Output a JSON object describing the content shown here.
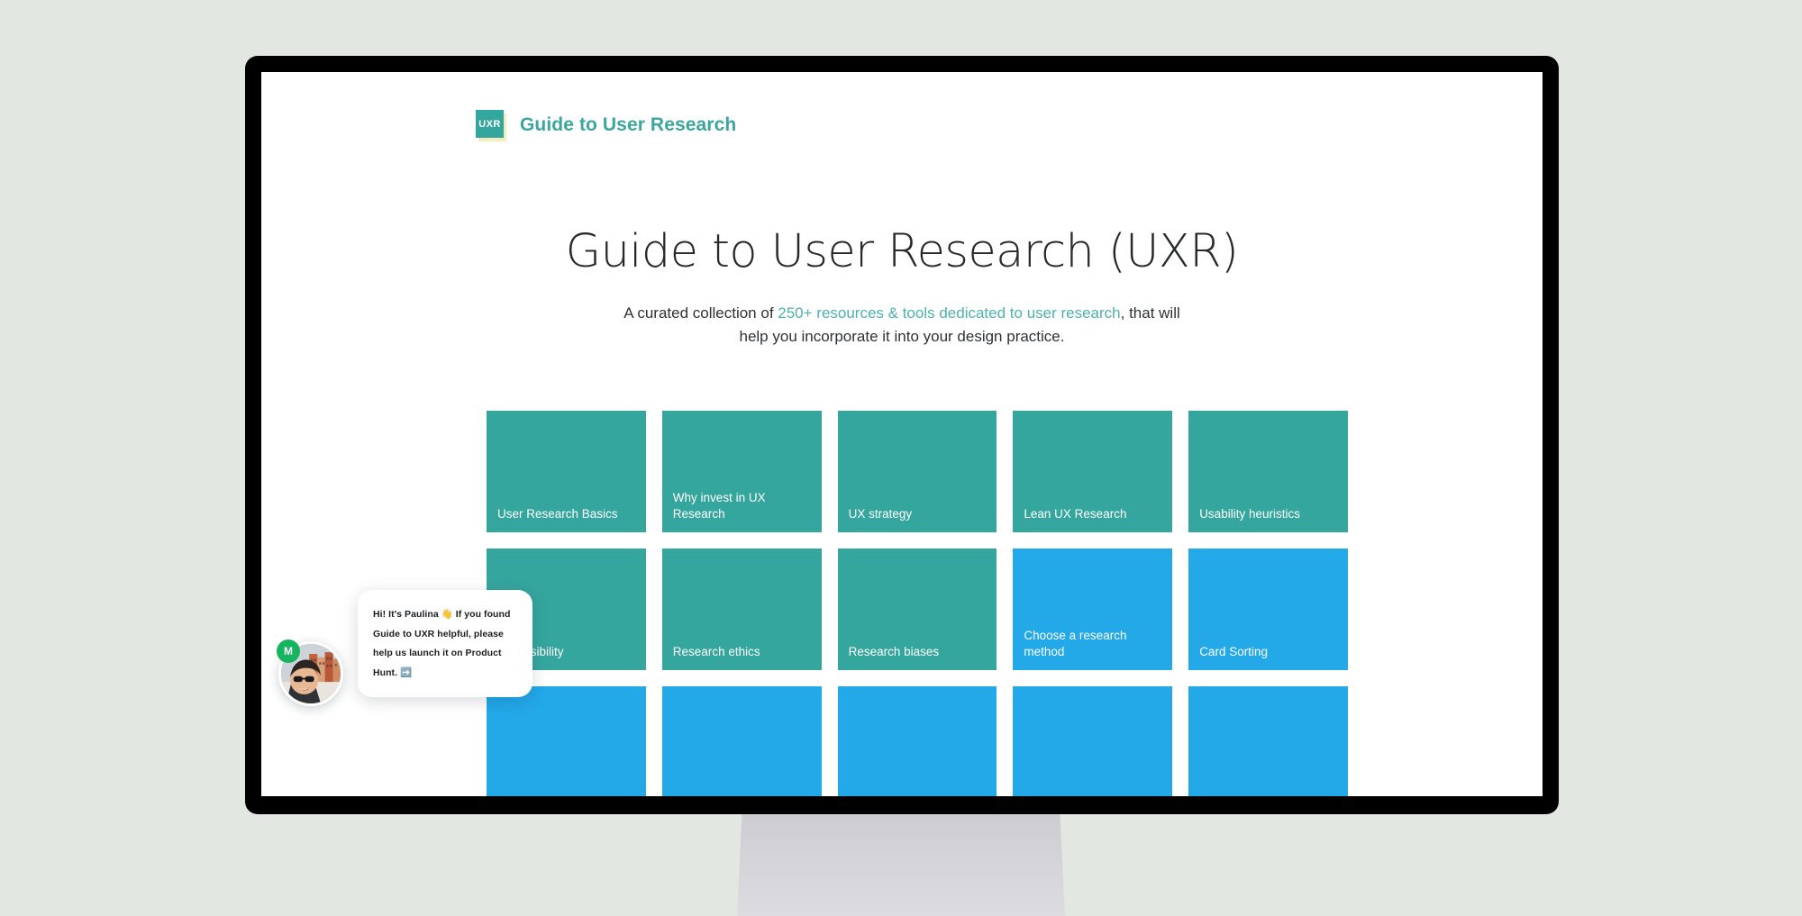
{
  "page": {
    "background_color": "#e2e7e2"
  },
  "monitor": {
    "bezel_color": "#000000",
    "stand_name": "monitor-stand"
  },
  "header": {
    "logo_text": "UXR",
    "brand_name": "Guide to User Research",
    "brand_color": "#3aa69d"
  },
  "hero": {
    "title": "Guide to User Research (UXR)",
    "subtitle_before": "A curated collection of ",
    "subtitle_link": "250+ resources & tools dedicated to user research",
    "subtitle_after": ", that will help you incorporate it into your design practice.",
    "link_color": "#4cb3ad"
  },
  "colors": {
    "teal": "#35a69e",
    "blue": "#23a8e8",
    "white": "#ffffff"
  },
  "cards": [
    {
      "label": "User Research Basics",
      "color": "#35a69e"
    },
    {
      "label": "Why invest in UX Research",
      "color": "#35a69e"
    },
    {
      "label": "UX strategy",
      "color": "#35a69e"
    },
    {
      "label": "Lean UX Research",
      "color": "#35a69e"
    },
    {
      "label": "Usability heuristics",
      "color": "#35a69e"
    },
    {
      "label": "Accessibility",
      "color": "#35a69e"
    },
    {
      "label": "Research ethics",
      "color": "#35a69e"
    },
    {
      "label": "Research biases",
      "color": "#35a69e"
    },
    {
      "label": "Choose a research method",
      "color": "#23a8e8"
    },
    {
      "label": "Card Sorting",
      "color": "#23a8e8"
    },
    {
      "label": "",
      "color": "#23a8e8"
    },
    {
      "label": "",
      "color": "#23a8e8"
    },
    {
      "label": "",
      "color": "#23a8e8"
    },
    {
      "label": "",
      "color": "#23a8e8"
    },
    {
      "label": "",
      "color": "#23a8e8"
    }
  ],
  "chat": {
    "message": "Hi! It's Paulina 👋 If you found Guide to UXR helpful, please help us launch it on Product Hunt. ➡️",
    "badge_initial": "M",
    "badge_color": "#16b45f"
  }
}
